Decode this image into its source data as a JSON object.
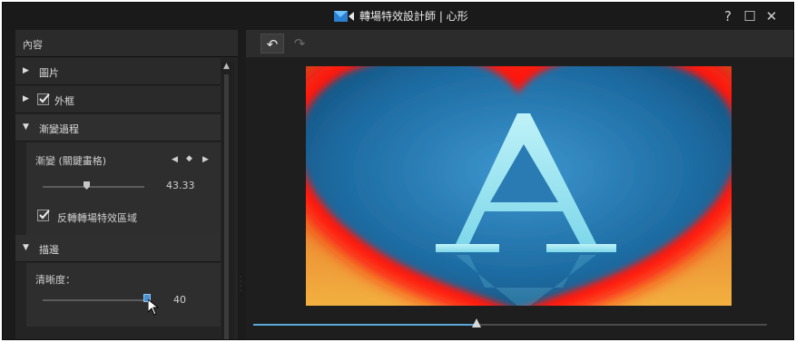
{
  "window": {
    "title": "轉場特效設計師 | 心形",
    "help_label": "?",
    "maximize_label": "☐",
    "close_label": "✕"
  },
  "left_panel": {
    "header": "內容",
    "sections": [
      {
        "label": "圖片",
        "expanded": false,
        "checkbox": false
      },
      {
        "label": "外框",
        "expanded": false,
        "checkbox": true,
        "checked": true
      },
      {
        "label": "漸變過程",
        "expanded": true,
        "checkbox": false
      },
      {
        "label": "描邊",
        "expanded": true,
        "checkbox": false
      }
    ],
    "transition": {
      "label": "漸變 (關鍵畫格)",
      "value": "43.33",
      "reverse_label": "反轉轉場特效區域",
      "reverse_checked": true
    },
    "stroke": {
      "label": "清晰度：",
      "value": "40"
    }
  },
  "preview": {
    "letter": "A"
  },
  "timeline": {
    "progress": 0.434
  },
  "colors": {
    "accent": "#5aa8d8",
    "heart_blue": "#1f6fa3",
    "ring_red": "#ff1a0a",
    "bg_orange": "#f0a030"
  }
}
